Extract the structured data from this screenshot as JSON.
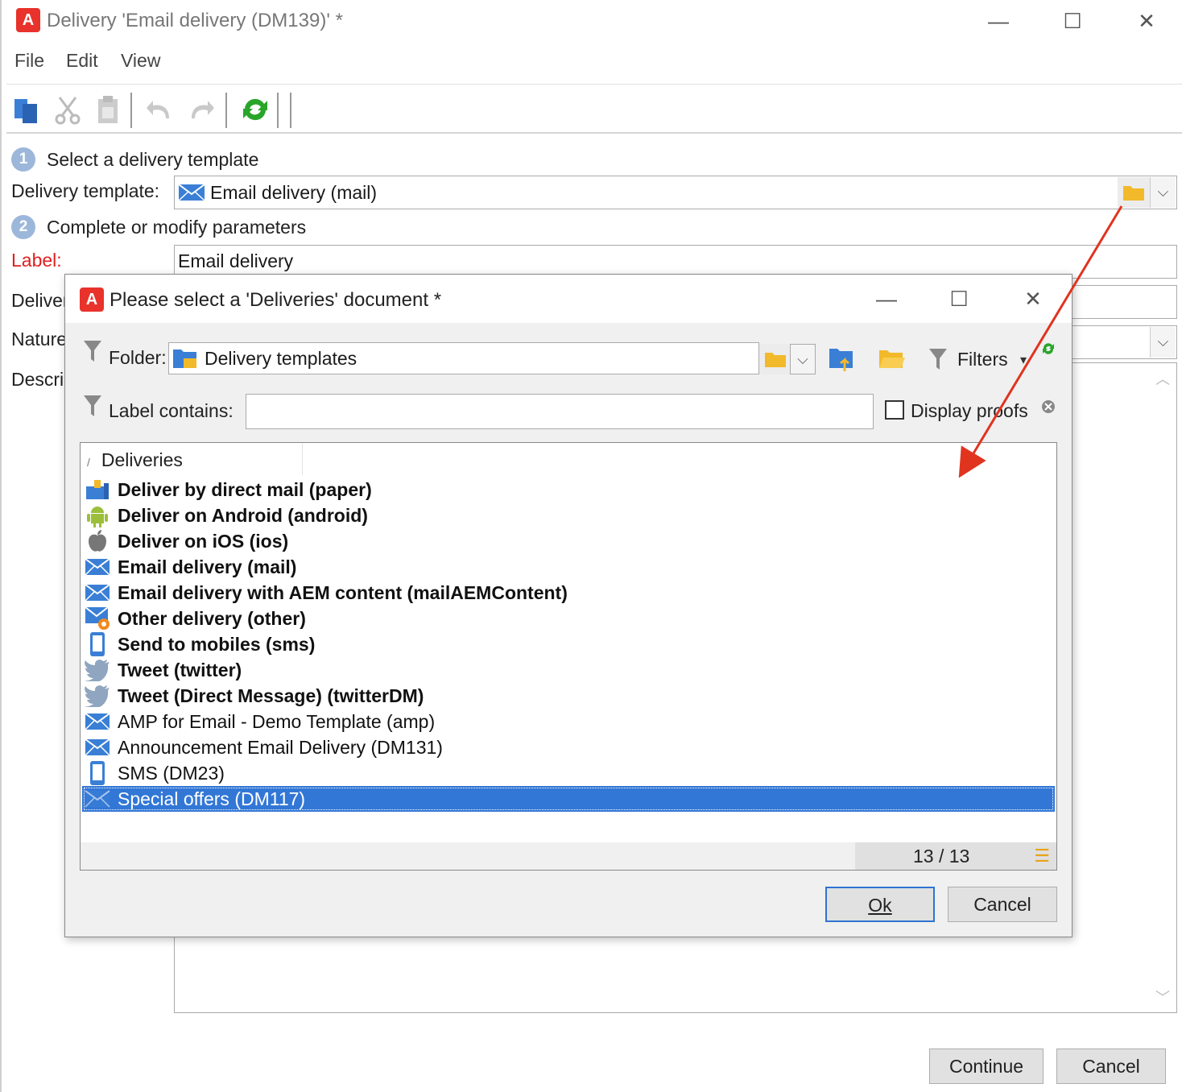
{
  "window": {
    "title": "Delivery 'Email delivery (DM139)' *",
    "app_icon_letter": "A",
    "minimize": "—",
    "maximize": "☐",
    "close": "✕"
  },
  "menu": [
    "File",
    "Edit",
    "View"
  ],
  "form": {
    "step1": {
      "num": "1",
      "label": "Select a delivery template"
    },
    "template_label": "Delivery template:",
    "template_value": "Email delivery (mail)",
    "step2": {
      "num": "2",
      "label": "Complete or modify parameters"
    },
    "label_label": "Label:",
    "label_value": "Email delivery",
    "delivery_label": "Deliver",
    "nature_label": "Nature",
    "description_label": "Descri",
    "continue_label": "Continue",
    "cancel_label": "Cancel"
  },
  "dialog": {
    "title": "Please select a 'Deliveries' document *",
    "folder_label": "Folder:",
    "folder_value": "Delivery templates",
    "filters_label": "Filters",
    "label_contains": "Label contains:",
    "label_contains_value": "",
    "display_proofs": "Display proofs",
    "list_header": "Deliveries",
    "rows": [
      {
        "label": "Deliver by direct mail (paper)",
        "icon": "paper-mail-icon",
        "bold": true
      },
      {
        "label": "Deliver on Android (android)",
        "icon": "android-icon",
        "bold": true
      },
      {
        "label": "Deliver on iOS (ios)",
        "icon": "apple-icon",
        "bold": true
      },
      {
        "label": "Email delivery (mail)",
        "icon": "envelope-icon",
        "bold": true
      },
      {
        "label": "Email delivery with AEM content (mailAEMContent)",
        "icon": "envelope-icon",
        "bold": true
      },
      {
        "label": "Other delivery (other)",
        "icon": "other-delivery-icon",
        "bold": true
      },
      {
        "label": "Send to mobiles (sms)",
        "icon": "mobile-icon",
        "bold": true
      },
      {
        "label": "Tweet (twitter)",
        "icon": "twitter-icon",
        "bold": true
      },
      {
        "label": "Tweet (Direct Message) (twitterDM)",
        "icon": "twitter-icon",
        "bold": true
      },
      {
        "label": "AMP for Email - Demo Template (amp)",
        "icon": "envelope-icon",
        "bold": false
      },
      {
        "label": "Announcement Email Delivery (DM131)",
        "icon": "envelope-icon",
        "bold": false
      },
      {
        "label": "SMS (DM23)",
        "icon": "mobile-icon",
        "bold": false
      },
      {
        "label": "Special offers (DM117)",
        "icon": "envelope-icon",
        "bold": false,
        "selected": true
      }
    ],
    "count": "13 / 13",
    "ok_label": "Ok",
    "cancel_label": "Cancel"
  },
  "colors": {
    "selection": "#3277d6",
    "envelope": "#3a7fd5",
    "folder": "#f2b92a",
    "refresh": "#29a529",
    "arrow": "#e0341f",
    "required": "#e02020"
  }
}
